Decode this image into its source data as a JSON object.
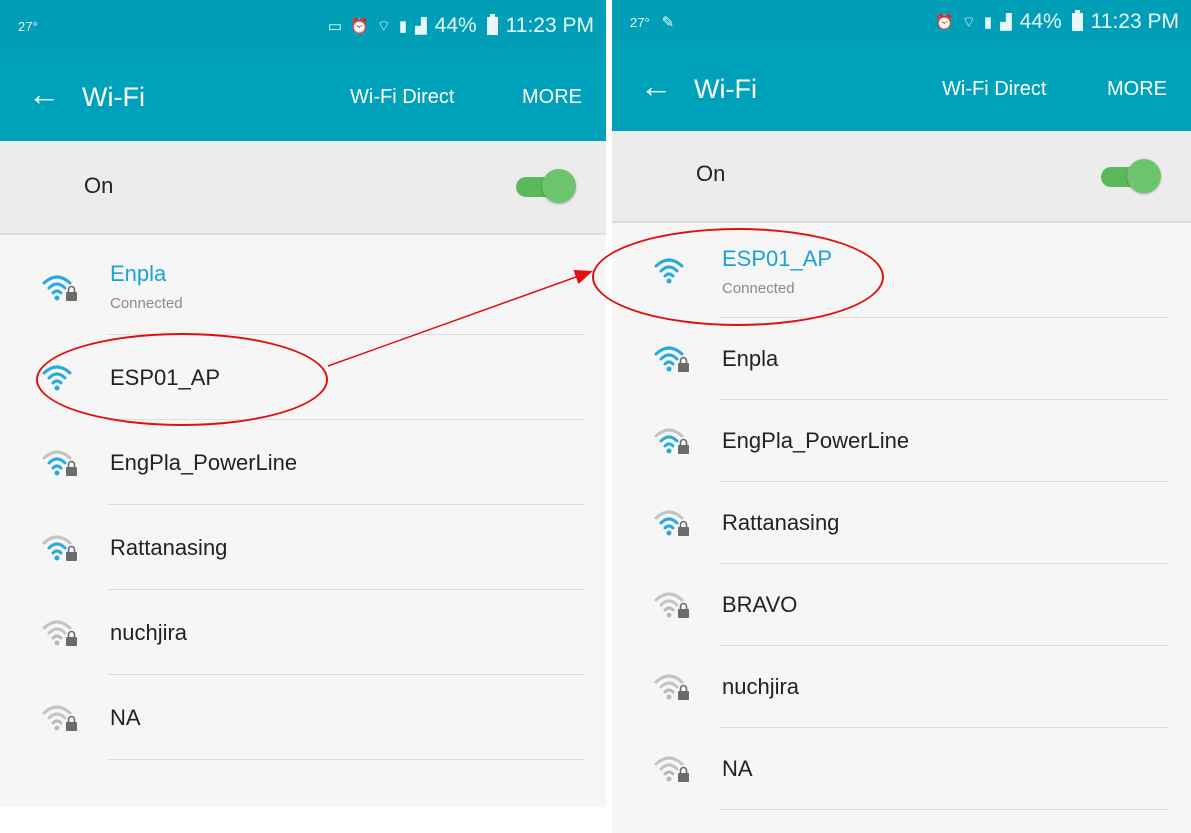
{
  "colors": {
    "accent": "#00a2bb",
    "connected": "#1aa3d9",
    "toggle": "#5cb85c",
    "annotation": "#e01010"
  },
  "left": {
    "status": {
      "temp": "27°",
      "battery": "44%",
      "time": "11:23 PM"
    },
    "toolbar": {
      "title": "Wi-Fi",
      "direct": "Wi-Fi Direct",
      "more": "MORE"
    },
    "toggle_label": "On",
    "networks": [
      {
        "name": "Enpla",
        "status": "Connected",
        "icon": "wifi-lock-icon",
        "signal": "strong"
      },
      {
        "name": "ESP01_AP",
        "icon": "wifi-icon",
        "signal": "strong"
      },
      {
        "name": "EngPla_PowerLine",
        "icon": "wifi-lock-icon",
        "signal": "medium"
      },
      {
        "name": "Rattanasing",
        "icon": "wifi-lock-icon",
        "signal": "medium"
      },
      {
        "name": "nuchjira",
        "icon": "wifi-lock-icon",
        "signal": "weak"
      },
      {
        "name": "NA",
        "icon": "wifi-lock-icon",
        "signal": "weak"
      }
    ]
  },
  "right": {
    "status": {
      "temp": "27°",
      "battery": "44%",
      "time": "11:23 PM"
    },
    "toolbar": {
      "title": "Wi-Fi",
      "direct": "Wi-Fi Direct",
      "more": "MORE"
    },
    "toggle_label": "On",
    "networks": [
      {
        "name": "ESP01_AP",
        "status": "Connected",
        "icon": "wifi-icon",
        "signal": "strong"
      },
      {
        "name": "Enpla",
        "icon": "wifi-lock-icon",
        "signal": "strong"
      },
      {
        "name": "EngPla_PowerLine",
        "icon": "wifi-lock-icon",
        "signal": "medium"
      },
      {
        "name": "Rattanasing",
        "icon": "wifi-lock-icon",
        "signal": "medium"
      },
      {
        "name": "BRAVO",
        "icon": "wifi-lock-icon",
        "signal": "weak"
      },
      {
        "name": "nuchjira",
        "icon": "wifi-lock-icon",
        "signal": "weak"
      },
      {
        "name": "NA",
        "icon": "wifi-lock-icon",
        "signal": "weak"
      }
    ]
  }
}
